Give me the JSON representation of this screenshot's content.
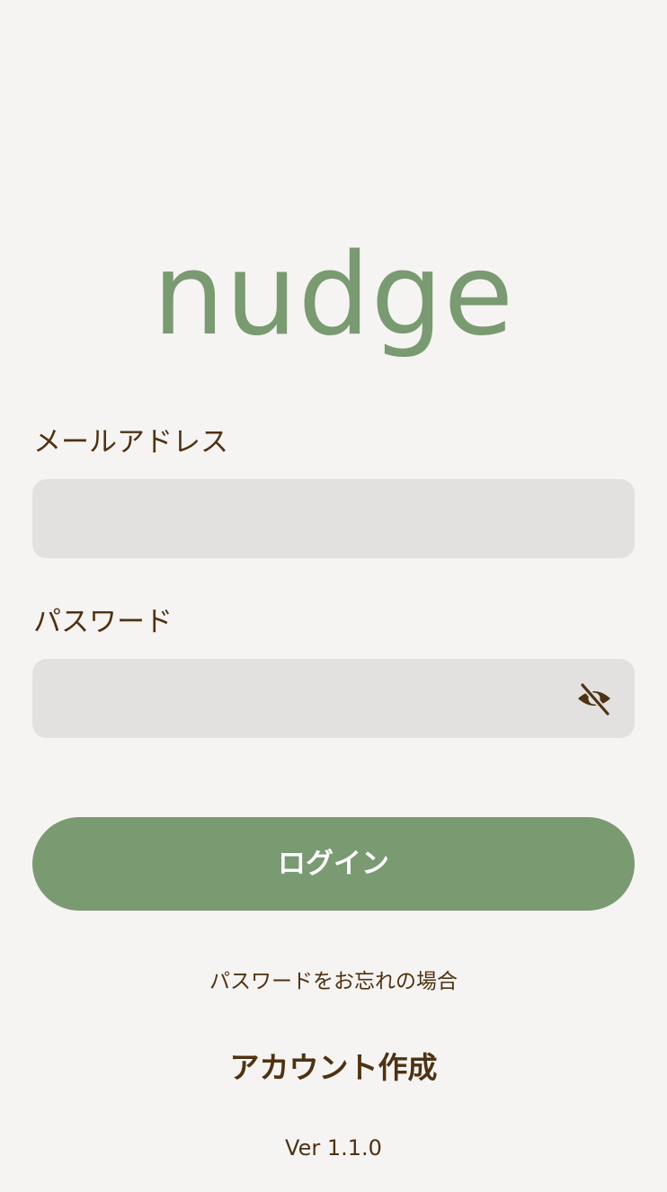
{
  "app": {
    "logo_text": "nudge",
    "logo_color": "#7a9a72"
  },
  "email": {
    "label": "メールアドレス",
    "value": "",
    "placeholder": ""
  },
  "password": {
    "label": "パスワード",
    "value": "",
    "placeholder": "",
    "toggle_icon": "eye-off-icon"
  },
  "login_button": {
    "label": "ログイン",
    "background": "#7a9a72"
  },
  "links": {
    "forgot_password": "パスワードをお忘れの場合",
    "create_account": "アカウント作成"
  },
  "footer": {
    "version": "Ver 1.1.0"
  },
  "colors": {
    "background": "#f6f4f2",
    "text": "#4e3212",
    "input_background": "#e2e1df"
  }
}
